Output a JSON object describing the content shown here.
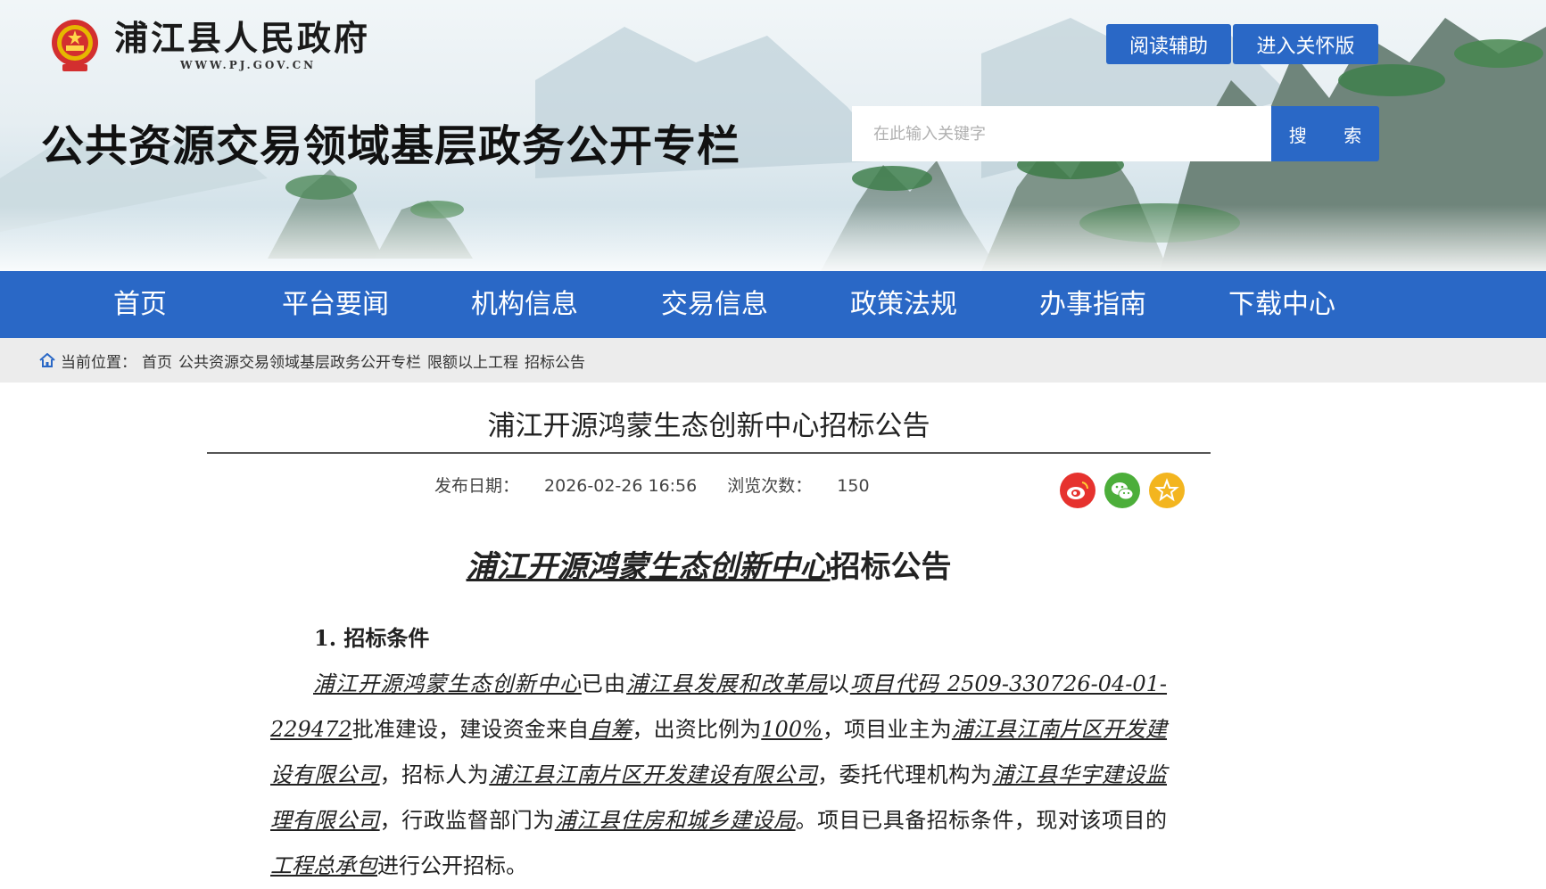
{
  "header": {
    "site_name": "浦江县人民政府",
    "site_url": "WWW.PJ.GOV.CN",
    "column_title": "公共资源交易领域基层政务公开专栏",
    "read_assist_label": "阅读辅助",
    "care_mode_label": "进入关怀版",
    "search_placeholder": "在此输入关键字",
    "search_button": "搜 索",
    "accent_color": "#2a68c6"
  },
  "nav": {
    "items": [
      "首页",
      "平台要闻",
      "机构信息",
      "交易信息",
      "政策法规",
      "办事指南",
      "下载中心"
    ]
  },
  "breadcrumb": {
    "label": "当前位置：",
    "items": [
      "首页",
      "公共资源交易领域基层政务公开专栏",
      "限额以上工程",
      "招标公告"
    ]
  },
  "article": {
    "title": "浦江开源鸿蒙生态创新中心招标公告",
    "publish_label": "发布日期：",
    "publish_date": "2026-02-26 16:56",
    "views_label": "浏览次数：",
    "views": "150",
    "share_icons": [
      "weibo-icon",
      "wechat-icon",
      "favorite-star-icon"
    ]
  },
  "document": {
    "title_underlined": "浦江开源鸿蒙生态创新中心",
    "title_rest": "招标公告",
    "section1_heading": "1. 招标条件",
    "p1": [
      {
        "t": "浦江开源鸿蒙生态创新中心",
        "u": true
      },
      {
        "t": "已由",
        "u": false
      },
      {
        "t": "浦江县发展和改革局",
        "u": true
      },
      {
        "t": "以",
        "u": false
      },
      {
        "t": "项目代码 2509-330726-04-01-229472",
        "u": true
      },
      {
        "t": "批准建设，建设资金来自",
        "u": false
      },
      {
        "t": "自筹",
        "u": true
      },
      {
        "t": "，出资比例为",
        "u": false
      },
      {
        "t": "100%",
        "u": true
      },
      {
        "t": "，项目业主为",
        "u": false
      },
      {
        "t": "浦江县江南片区开发建设有限公司",
        "u": true
      },
      {
        "t": "，招标人为",
        "u": false
      },
      {
        "t": "浦江县江南片区开发建设有限公司",
        "u": true
      },
      {
        "t": "，委托代理机构为",
        "u": false
      },
      {
        "t": "浦江县华宇建设监理有限公司",
        "u": true
      },
      {
        "t": "，行政监督部门为",
        "u": false
      },
      {
        "t": "浦江县住房和城乡建设局",
        "u": true
      },
      {
        "t": "。项目已具备招标条件，现对该项目的",
        "u": false
      },
      {
        "t": "工程总承包",
        "u": true
      },
      {
        "t": "进行公开招标。",
        "u": false
      }
    ]
  }
}
